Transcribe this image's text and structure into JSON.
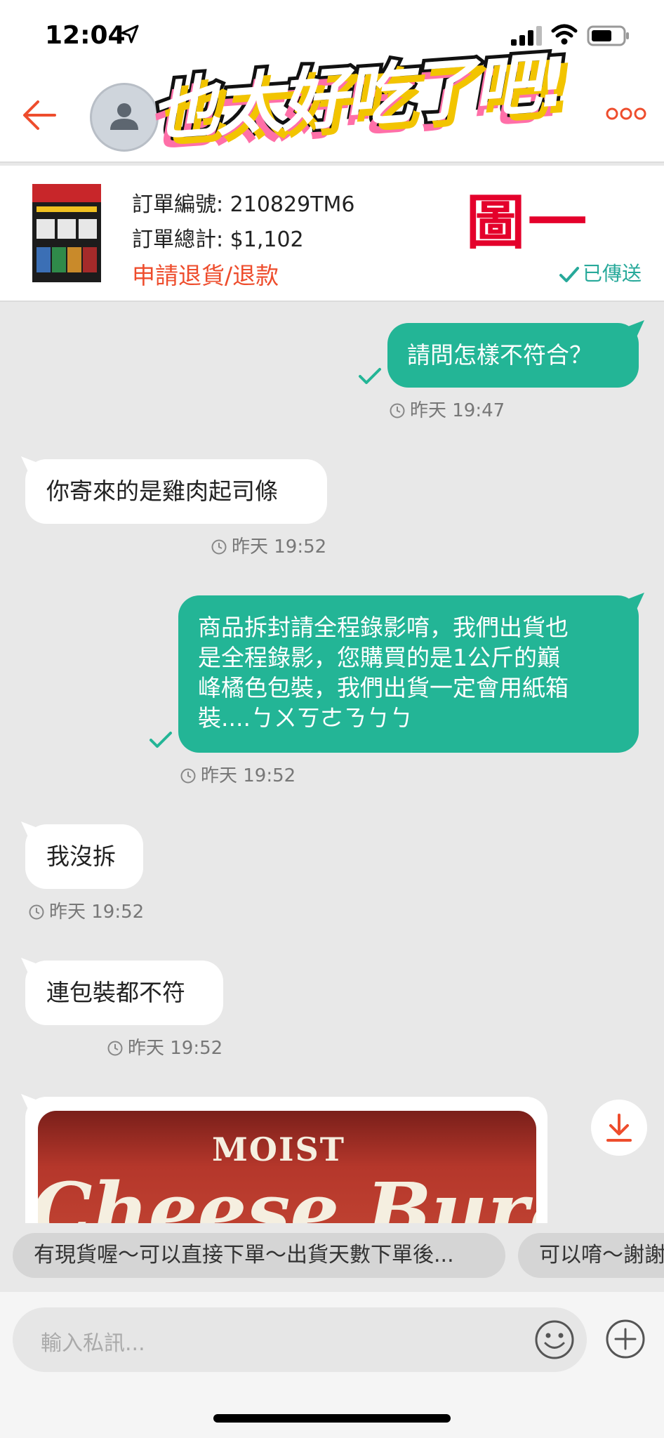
{
  "status_bar": {
    "time": "12:04"
  },
  "header": {
    "sticker_text": "也太好吃了吧!"
  },
  "order": {
    "number": "訂單編號: 210829TM6",
    "total": "訂單總計: $1,102",
    "action": "申請退貨/退款",
    "figure_label": "圖一",
    "status": "已傳送"
  },
  "messages": [
    {
      "from": "me",
      "text": "請問怎樣不符合？",
      "time": "昨天 19:47"
    },
    {
      "from": "them",
      "text": "你寄來的是雞肉起司條",
      "time": "昨天 19:52"
    },
    {
      "from": "me",
      "line1": "商品拆封請全程錄影唷，我們出貨也",
      "line2": "是全程錄影，您購買的是1公斤的巔",
      "line3": "峰橘色包裝，我們出貨一定會用紙箱",
      "line4": "裝....ㄅㄨㄎㄜㄋㄅㄅ",
      "time": "昨天 19:52"
    },
    {
      "from": "them",
      "text": "我沒拆",
      "time": "昨天 19:52"
    },
    {
      "from": "them",
      "text": "連包裝都不符",
      "time": "昨天 19:52"
    }
  ],
  "image_message": {
    "text_top": "MOIST",
    "text_main": "Cheese Burge"
  },
  "quick_replies": [
    "有現貨喔～可以直接下單～出貨天數下單後...",
    "可以唷～謝謝"
  ],
  "input": {
    "placeholder": "輸入私訊..."
  },
  "colors": {
    "accent": "#ee4d2d",
    "bubble_me": "#23b596",
    "sent_status": "#27a99a",
    "figure_label": "#e4002b"
  }
}
